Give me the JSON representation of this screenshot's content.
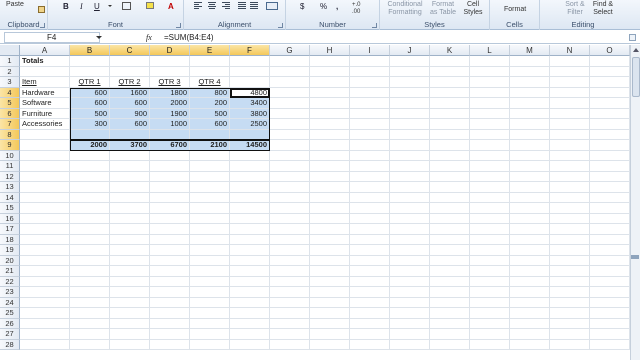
{
  "ribbon": {
    "clipboard": {
      "paste": "Paste",
      "label": "Clipboard"
    },
    "font": {
      "bold": "B",
      "italic": "I",
      "underline": "U",
      "label": "Font"
    },
    "alignment": {
      "label": "Alignment"
    },
    "number": {
      "currency": "$",
      "percent": "%",
      "comma": ",",
      "label": "Number",
      "dec_inc": ".00",
      "dec_dec": "+.0"
    },
    "styles": {
      "conditional": [
        "Conditional",
        "Formatting"
      ],
      "format_table": [
        "Format",
        "as Table"
      ],
      "cell_styles": [
        "Cell",
        "Styles"
      ],
      "label": "Styles"
    },
    "cells": {
      "format": "Format",
      "label": "Cells"
    },
    "editing": {
      "sort": [
        "Sort &",
        "Filter"
      ],
      "find": [
        "Find &",
        "Select"
      ],
      "label": "Editing"
    }
  },
  "formula_bar": {
    "name_box": "F4",
    "fx": "fx",
    "formula": "=SUM(B4:E4)"
  },
  "columns": [
    "A",
    "B",
    "C",
    "D",
    "E",
    "F",
    "G",
    "H",
    "I",
    "J",
    "K",
    "L",
    "M",
    "N",
    "O"
  ],
  "rows": [
    "1",
    "2",
    "3",
    "4",
    "5",
    "6",
    "7",
    "8",
    "9",
    "10",
    "11",
    "12",
    "13",
    "14",
    "15",
    "16",
    "17",
    "18",
    "19",
    "20",
    "21",
    "22",
    "23",
    "24",
    "25",
    "26",
    "27",
    "28"
  ],
  "sheet": {
    "title": "Totals",
    "header": [
      "Item",
      "QTR 1",
      "QTR 2",
      "QTR 3",
      "QTR 4"
    ],
    "data_rows": [
      [
        "Hardware",
        "600",
        "1600",
        "1800",
        "800",
        "4800"
      ],
      [
        "Software",
        "600",
        "600",
        "2000",
        "200",
        "3400"
      ],
      [
        "Furniture",
        "500",
        "900",
        "1900",
        "500",
        "3800"
      ],
      [
        "Accessories",
        "300",
        "600",
        "1000",
        "600",
        "2500"
      ]
    ],
    "totals": [
      "2000",
      "3700",
      "6700",
      "2100",
      "14500"
    ]
  },
  "colors": {
    "selection": "#c6dcf3",
    "header_selected": "#f4c85a",
    "ribbon": "#dde7f3"
  }
}
